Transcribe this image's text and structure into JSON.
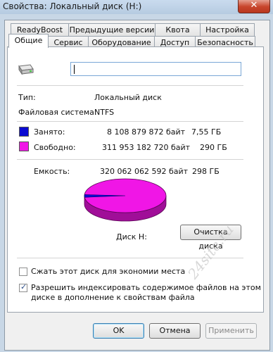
{
  "window": {
    "title": "Свойства: Локальный диск (H:)",
    "close_label": "✕"
  },
  "tabs_row1": [
    "ReadyBoost",
    "Предыдущие версии",
    "Квота",
    "Настройка"
  ],
  "tabs_row2": [
    "Общие",
    "Сервис",
    "Оборудование",
    "Доступ",
    "Безопасность"
  ],
  "active_tab": "Общие",
  "drive_name_value": "",
  "type": {
    "label": "Тип:",
    "value": "Локальный диск"
  },
  "filesystem": {
    "label": "Файловая система:",
    "value": "NTFS"
  },
  "used": {
    "label": "Занято:",
    "bytes": "8 108 879 872 байт",
    "size": "7,55 ГБ",
    "color": "#0a0ad2"
  },
  "free": {
    "label": "Свободно:",
    "bytes": "311 953 182 720 байт",
    "size": "290 ГБ",
    "color": "#f016e6"
  },
  "capacity": {
    "label": "Емкость:",
    "bytes": "320 062 062 592 байт",
    "size": "298 ГБ"
  },
  "pie": {
    "used_fraction": 0.0253
  },
  "disk_label": "Диск H:",
  "cleanup_button": "Очистка диска",
  "compress_checkbox": {
    "label": "Сжать этот диск для экономии места",
    "checked": false
  },
  "index_checkbox": {
    "label_line1": "Разрешить индексировать содержимое файлов на этом",
    "label_line2": "диске в дополнение к свойствам файла",
    "checked": true
  },
  "buttons": {
    "ok": "OK",
    "cancel": "Отмена",
    "apply": "Применить"
  },
  "watermark": "24site.ru"
}
